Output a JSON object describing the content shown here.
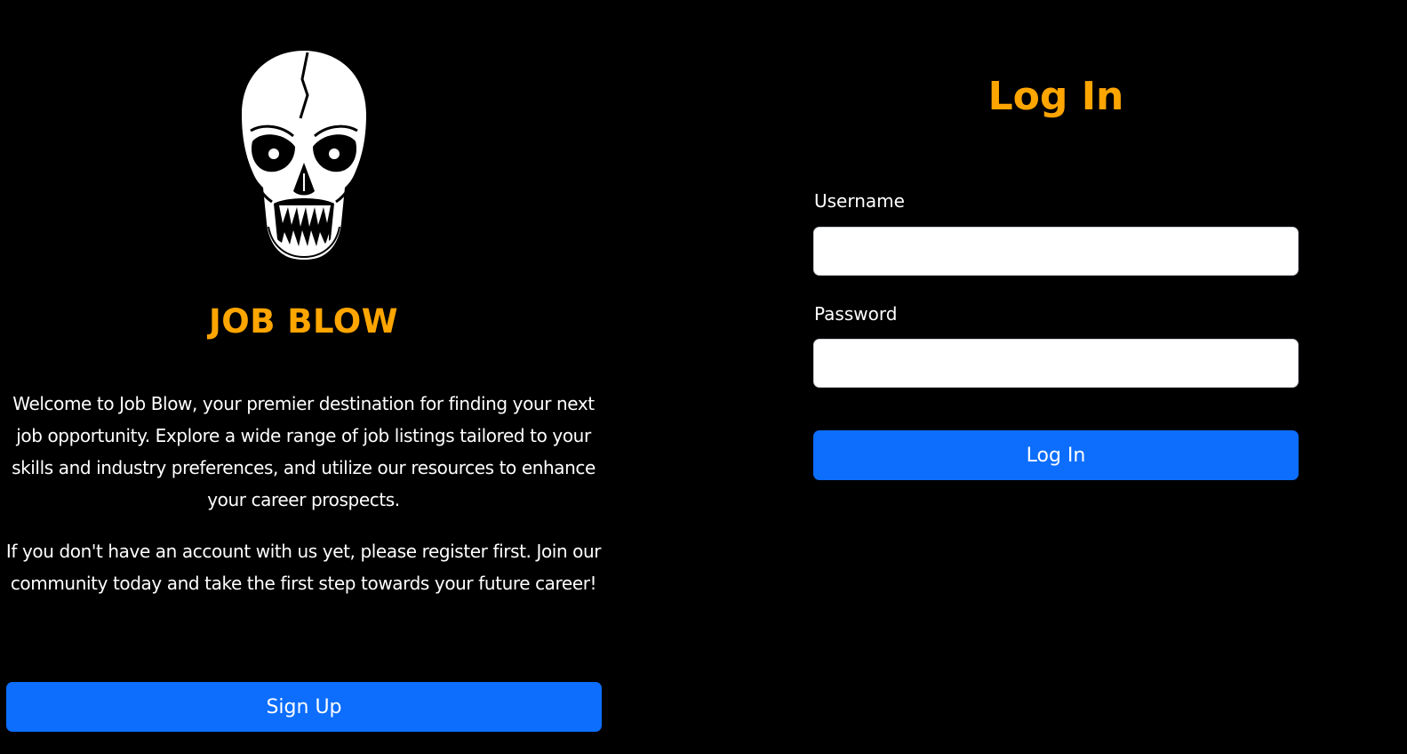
{
  "brand": {
    "name": "JOB BLOW",
    "logo_icon": "skull-icon",
    "accent_color": "#FFA500"
  },
  "intro": {
    "paragraph_1": "Welcome to Job Blow, your premier destination for finding your next job opportunity. Explore a wide range of job listings tailored to your skills and industry preferences, and utilize our resources to enhance your career prospects.",
    "paragraph_2": "If you don't have an account with us yet, please register first. Join our community today and take the first step towards your future career!"
  },
  "signup": {
    "button_label": "Sign Up"
  },
  "login": {
    "title": "Log In",
    "username_label": "Username",
    "username_value": "",
    "password_label": "Password",
    "password_value": "",
    "submit_label": "Log In"
  },
  "colors": {
    "background": "#000000",
    "text": "#FFFFFF",
    "button": "#0D6EFD",
    "field_background": "#FFFFFF"
  }
}
